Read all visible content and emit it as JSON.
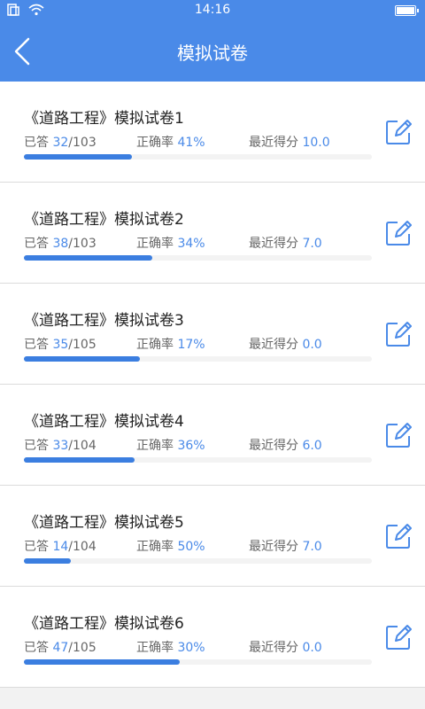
{
  "status_bar": {
    "time": "14:16",
    "icons": [
      "sim-icon",
      "wifi-icon",
      "battery-icon"
    ]
  },
  "header": {
    "title": "模拟试卷",
    "back_icon": "back-chevron-icon"
  },
  "colors": {
    "primary": "#4a8ae8",
    "progress": "#3b7ee0"
  },
  "labels": {
    "answered": "已答",
    "accuracy": "正确率",
    "recent_score": "最近得分",
    "separator": "/"
  },
  "papers": [
    {
      "title": "《道路工程》模拟试卷1",
      "answered": "32",
      "total": "103",
      "accuracy": "41%",
      "score": "10.0",
      "progress": 0.311
    },
    {
      "title": "《道路工程》模拟试卷2",
      "answered": "38",
      "total": "103",
      "accuracy": "34%",
      "score": "7.0",
      "progress": 0.369
    },
    {
      "title": "《道路工程》模拟试卷3",
      "answered": "35",
      "total": "105",
      "accuracy": "17%",
      "score": "0.0",
      "progress": 0.333
    },
    {
      "title": "《道路工程》模拟试卷4",
      "answered": "33",
      "total": "104",
      "accuracy": "36%",
      "score": "6.0",
      "progress": 0.317
    },
    {
      "title": "《道路工程》模拟试卷5",
      "answered": "14",
      "total": "104",
      "accuracy": "50%",
      "score": "7.0",
      "progress": 0.135
    },
    {
      "title": "《道路工程》模拟试卷6",
      "answered": "47",
      "total": "105",
      "accuracy": "30%",
      "score": "0.0",
      "progress": 0.448
    }
  ]
}
